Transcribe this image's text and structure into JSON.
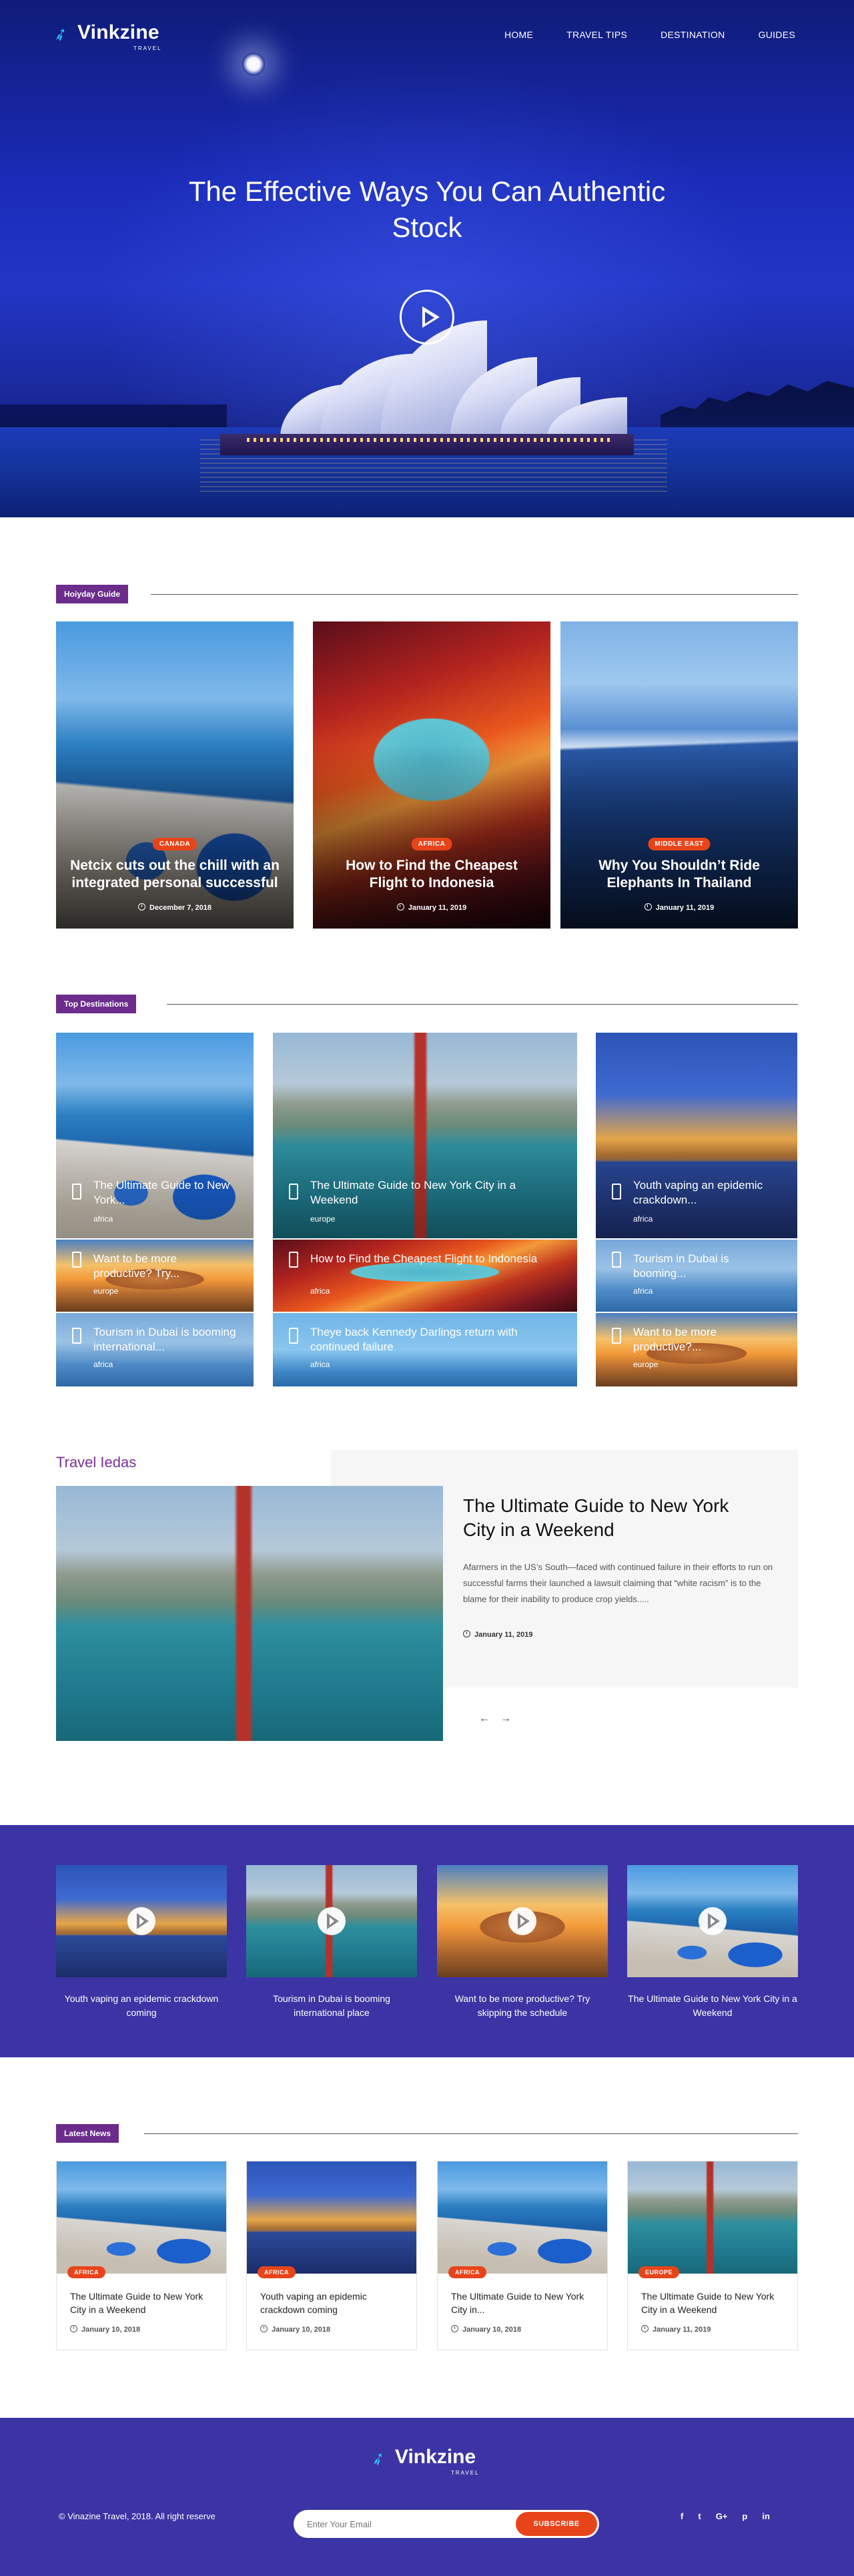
{
  "header": {
    "logo_name": "Vinkzine",
    "logo_sub": "TRAVEL",
    "nav": [
      "HOME",
      "TRAVEL TIPS",
      "DESTINATION",
      "GUIDES"
    ]
  },
  "hero": {
    "title": "The Effective Ways You Can Authentic Stock"
  },
  "holiday": {
    "label": "Hoiyday Guide",
    "cards": [
      {
        "tag": "CANADA",
        "title": "Netcix cuts out the chill with an integrated personal successful",
        "date": "December 7, 2018"
      },
      {
        "tag": "AFRICA",
        "title": "How to Find the Cheapest Flight to Indonesia",
        "date": "January 11, 2019"
      },
      {
        "tag": "MIDDLE EAST",
        "title": "Why You Shouldn’t Ride Elephants In Thailand",
        "date": "January 11, 2019"
      }
    ]
  },
  "destinations": {
    "label": "Top Destinations",
    "items": [
      {
        "title": "The Ultimate Guide to New York...",
        "category": "africa"
      },
      {
        "title": "The Ultimate Guide to New York City in a Weekend",
        "category": "europe"
      },
      {
        "title": "Youth vaping an epidemic crackdown...",
        "category": "africa"
      },
      {
        "title": "Want to be more productive? Try...",
        "category": "europe"
      },
      {
        "title": "How to Find the Cheapest Flight to Indonesia",
        "category": "africa"
      },
      {
        "title": "Tourism in Dubai is booming...",
        "category": "africa"
      },
      {
        "title": "Tourism in Dubai is booming international...",
        "category": "africa"
      },
      {
        "title": "Theye back Kennedy Darlings return with continued failure",
        "category": "africa"
      },
      {
        "title": "Want to be more productive?...",
        "category": "europe"
      }
    ]
  },
  "ideas": {
    "label": "Travel Iedas",
    "title": "The Ultimate Guide to New York City in a Weekend",
    "excerpt": "Afarmers in the US’s South—faced with continued failure in their efforts to run on successful farms their launched a lawsuit claiming that “white racism” is to the blame for their inability to produce crop yields.....",
    "date": "January 11, 2019",
    "prev": "←",
    "next": "→"
  },
  "videos": [
    {
      "title": "Youth vaping an epidemic crackdown coming"
    },
    {
      "title": "Tourism in Dubai is booming international place"
    },
    {
      "title": "Want to be more productive? Try skipping the schedule"
    },
    {
      "title": "The Ultimate Guide to New York City in a Weekend"
    }
  ],
  "news": {
    "label": "Latest News",
    "cards": [
      {
        "tag": "AFRICA",
        "title": "The Ultimate Guide to New York City in a Weekend",
        "date": "January 10, 2018"
      },
      {
        "tag": "AFRICA",
        "title": "Youth vaping an epidemic crackdown coming",
        "date": "January 10, 2018"
      },
      {
        "tag": "AFRICA",
        "title": "The Ultimate Guide to New York City in...",
        "date": "January 10, 2018"
      },
      {
        "tag": "EUROPE",
        "title": "The Ultimate Guide to New York City in a Weekend",
        "date": "January 11, 2019"
      }
    ]
  },
  "footer": {
    "logo_name": "Vinkzine",
    "logo_sub": "TRAVEL",
    "copyright": "© Vinazine Travel, 2018. All right reserve",
    "email_placeholder": "Enter Your Email",
    "subscribe": "SUBSCRIBE",
    "social": [
      "f",
      "t",
      "G+",
      "p",
      "in"
    ]
  },
  "colors": {
    "accent": "#6b2c8c",
    "tag": "#e8441a",
    "band": "#3c34a4"
  }
}
